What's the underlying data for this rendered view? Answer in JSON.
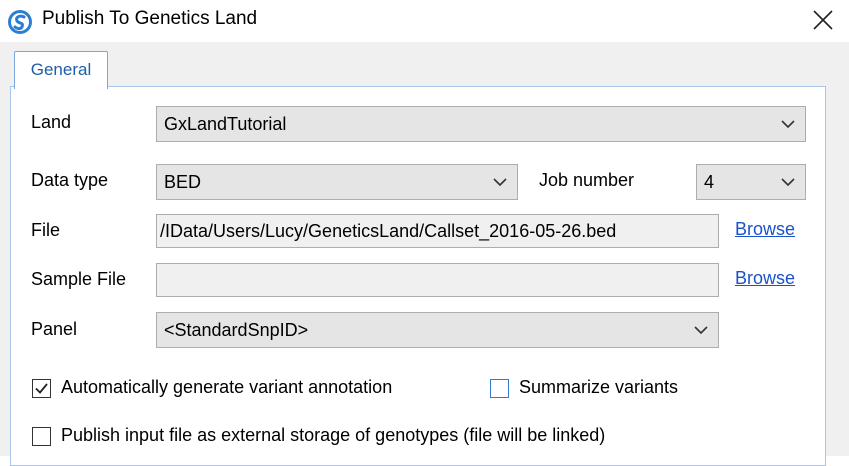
{
  "window": {
    "title": "Publish To Genetics Land",
    "app_icon": "app-logo-icon",
    "close_icon": "close-icon"
  },
  "tabs": [
    {
      "label": "General",
      "selected": true
    }
  ],
  "form": {
    "land": {
      "label": "Land",
      "value": "GxLandTutorial"
    },
    "data_type": {
      "label": "Data type",
      "value": "BED"
    },
    "job_number": {
      "label": "Job number",
      "value": "4"
    },
    "file": {
      "label": "File",
      "value": "/IData/Users/Lucy/GeneticsLand/Callset_2016-05-26.bed",
      "browse": "Browse"
    },
    "sample_file": {
      "label": "Sample File",
      "value": "",
      "browse": "Browse"
    },
    "panel": {
      "label": "Panel",
      "value": "<StandardSnpID>"
    },
    "auto_annotation": {
      "label": "Automatically generate variant annotation",
      "checked": true
    },
    "summarize": {
      "label": "Summarize variants",
      "checked": false
    },
    "publish_external": {
      "label": "Publish input file as external storage of genotypes (file will be linked)",
      "checked": false
    }
  },
  "colors": {
    "link": "#1a53c9",
    "tab_text": "#1e5ea8",
    "panel_border": "#a9c6e8",
    "focus_border": "#2f7bd6"
  }
}
